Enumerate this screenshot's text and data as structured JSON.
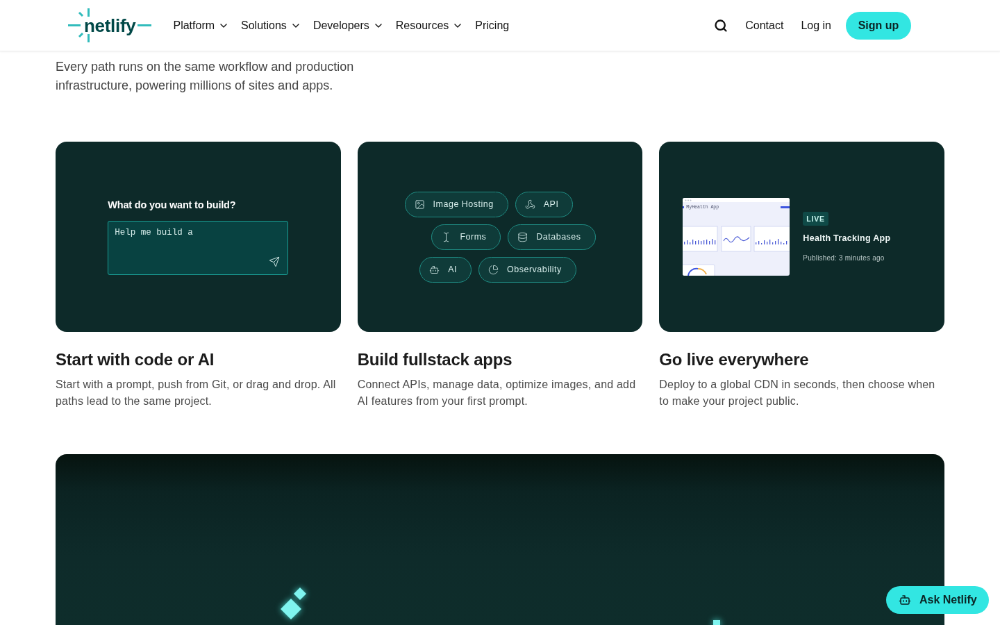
{
  "header": {
    "logo": "netlify",
    "nav": [
      {
        "label": "Platform",
        "has_menu": true
      },
      {
        "label": "Solutions",
        "has_menu": true
      },
      {
        "label": "Developers",
        "has_menu": true
      },
      {
        "label": "Resources",
        "has_menu": true
      },
      {
        "label": "Pricing",
        "has_menu": false
      }
    ],
    "links": [
      "Contact",
      "Log in"
    ],
    "signup": "Sign up"
  },
  "hero": {
    "subtitle": "Every path runs on the same workflow and production infrastructure, powering millions of sites and apps."
  },
  "cards": [
    {
      "kind": "prompt",
      "prompt": {
        "label": "What do you want to build?",
        "value": "Help me build a"
      },
      "title": "Start with code or AI",
      "description": "Start with a prompt, push from Git, or drag and drop. All paths lead to the same project."
    },
    {
      "kind": "features",
      "chip_rows": [
        [
          "Image Hosting",
          "API"
        ],
        [
          "Forms",
          "Databases"
        ],
        [
          "AI",
          "Observability"
        ]
      ],
      "title": "Build fullstack apps",
      "description": "Connect APIs, manage data, optimize images, and add AI features from your first prompt."
    },
    {
      "kind": "deploy",
      "deploy": {
        "preview_title": "MyHealth App",
        "badge": "LIVE",
        "app_name": "Health Tracking App",
        "published": "Published: 3 minutes ago"
      },
      "title": "Go live everywhere",
      "description": "Deploy to a global CDN in seconds, then choose when to make your project public."
    }
  ],
  "ask_button": "Ask Netlify"
}
